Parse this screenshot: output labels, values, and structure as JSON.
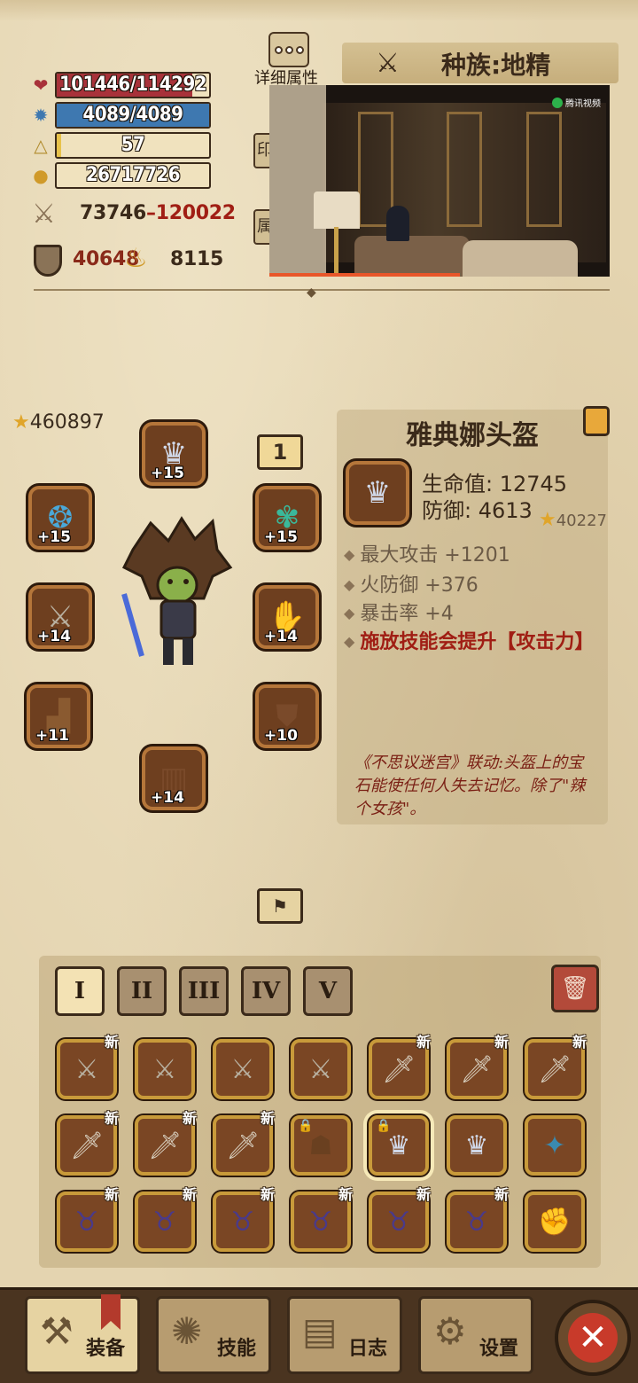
{
  "stats": {
    "hp": {
      "text": "101446/114292",
      "fill": 0.888,
      "icon": "heart-icon",
      "color": "#a8323a"
    },
    "mp": {
      "text": "4089/4089",
      "fill": 1.0,
      "icon": "mana-gear-icon",
      "color": "#3e78b0"
    },
    "level": {
      "text": "57",
      "fill": 0.03,
      "icon": "level-triangle-icon",
      "color": "#e8c24a"
    },
    "gold": {
      "text": "26717726",
      "icon": "gold-coins-icon"
    },
    "attack": {
      "min": "73746",
      "sep": "–",
      "max": "120022",
      "icon": "crossed-swords-icon"
    },
    "defense": {
      "value": "40648",
      "icon": "shield-icon"
    },
    "luck": {
      "value": "8115",
      "icon": "luck-horn-icon"
    }
  },
  "header": {
    "detail_label": "详细属性",
    "race_label": "种族:地精",
    "side_tab_1": "印",
    "side_tab_2": "属"
  },
  "video": {
    "logo_text": "腾讯视频",
    "progress": 0.56
  },
  "equipment": {
    "power": "460897",
    "page_badge": "1",
    "slots": [
      {
        "name": "helmet",
        "level": "+15",
        "icon": "helmet-icon"
      },
      {
        "name": "ring-left",
        "level": "+15",
        "icon": "ring-icon"
      },
      {
        "name": "amulet",
        "level": "+15",
        "icon": "amulet-icon"
      },
      {
        "name": "weapon",
        "level": "+14",
        "icon": "sword-icon"
      },
      {
        "name": "gloves",
        "level": "+14",
        "icon": "gloves-icon"
      },
      {
        "name": "boots",
        "level": "+11",
        "icon": "boots-icon"
      },
      {
        "name": "armor",
        "level": "+10",
        "icon": "armor-icon"
      },
      {
        "name": "pants",
        "level": "+14",
        "icon": "pants-icon"
      }
    ]
  },
  "item_detail": {
    "title": "雅典娜头盔",
    "hp_line": "生命值: 12745",
    "def_line": "防御: 4613",
    "score": "40227",
    "bonuses": [
      "最大攻击 +1201",
      "火防御 +376",
      "暴击率 +4"
    ],
    "special": "施放技能会提升【攻击力】",
    "flavor": "《不思议迷宫》联动:头盔上的宝石能使任何人失去记忆。除了\"辣个女孩\"。"
  },
  "inventory": {
    "tabs": [
      "I",
      "II",
      "III",
      "IV",
      "V"
    ],
    "active_tab": 0,
    "new_badge": "新",
    "trash_icon": "trash-icon",
    "rows": [
      [
        {
          "icon": "sword-icon",
          "new": true
        },
        {
          "icon": "sword-icon",
          "new": false
        },
        {
          "icon": "sword-icon",
          "new": false
        },
        {
          "icon": "sword-icon",
          "new": false
        },
        {
          "icon": "dagger-icon",
          "new": true
        },
        {
          "icon": "dagger-icon",
          "new": true
        },
        {
          "icon": "dagger-icon",
          "new": true
        }
      ],
      [
        {
          "icon": "dagger-icon",
          "new": true
        },
        {
          "icon": "dagger-icon",
          "new": true
        },
        {
          "icon": "dagger-icon",
          "new": true
        },
        {
          "icon": "beast-mask-icon",
          "new": false,
          "lock": true
        },
        {
          "icon": "helmet-icon",
          "new": false,
          "lock": true,
          "selected": true
        },
        {
          "icon": "helmet-icon",
          "new": false
        },
        {
          "icon": "crystal-amulet-icon",
          "new": false
        }
      ],
      [
        {
          "icon": "demon-helm-icon",
          "new": true
        },
        {
          "icon": "demon-helm-icon",
          "new": true
        },
        {
          "icon": "demon-helm-icon",
          "new": true
        },
        {
          "icon": "demon-helm-icon",
          "new": true
        },
        {
          "icon": "demon-helm-icon",
          "new": true
        },
        {
          "icon": "demon-helm-icon",
          "new": true
        },
        {
          "icon": "gauntlet-icon",
          "new": false
        }
      ]
    ]
  },
  "nav": {
    "equip": "装备",
    "skill": "技能",
    "log": "日志",
    "settings": "设置"
  }
}
